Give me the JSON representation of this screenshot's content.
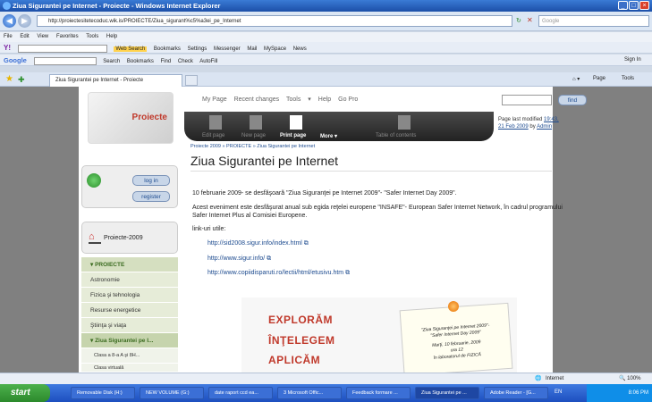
{
  "window": {
    "title": "Ziua Sigurantei pe Internet - Proiecte - Windows Internet Explorer"
  },
  "address": {
    "url": "http://proiectesitetecoduc.wik.is/PROIECTE/Ziua_sigurant%c5%a3ei_pe_Internet",
    "search_placeholder": "Google"
  },
  "menu": [
    "File",
    "Edit",
    "View",
    "Favorites",
    "Tools",
    "Help"
  ],
  "toolbar1": [
    "Web Search",
    "Bookmarks",
    "Settings",
    "Messenger",
    "Mail",
    "MySpace",
    "News"
  ],
  "toolbar2": [
    "Search",
    "Bookmarks",
    "Find",
    "Check",
    "AutoFill"
  ],
  "toolbar2_right": "Sign In",
  "tab": {
    "label": "Ziua Sigurantei pe Internet - Proiecte"
  },
  "cmdbar": [
    "Page",
    "Tools"
  ],
  "wiki": {
    "logo_text": "Proiecte",
    "login": "log in",
    "register": "register",
    "project_label": "Proiecte-2009",
    "sidebar": [
      "PROIECTE",
      "Astronomie",
      "Fizica şi tehnologia",
      "Resurse energetice",
      "Ştiinţa şi viaţa",
      "Ziua Sigurantei pe I...",
      "Clasa a 8-a A şi 8H...",
      "Clasa virtuală"
    ],
    "topnav": [
      "My Page",
      "Recent changes",
      "Tools",
      "Help",
      "Go Pro"
    ],
    "find": "find",
    "actions": [
      "Edit page",
      "New page",
      "Print page",
      "More",
      "Table of contents"
    ],
    "modified_prefix": "Page last modified",
    "modified_time": "19:43, 21 Feb 2009",
    "modified_by": "by",
    "modified_author": "Admin",
    "breadcrumb": "Proiecte 2009 » PROIECTE » Ziua Sigurantei pe Internet",
    "title": "Ziua Sigurantei pe Internet",
    "para1": "10 februarie 2009- se desfăşoară \"Ziua Siguranţei pe Internet 2009\"- \"Safer Internet Day 2009\".",
    "para2": "Acest eveniment este desfăşurat anual sub egida reţelei europene \"INSAFE\"- European Safer Internet Network, în cadrul programului Safer Internet Plus al Comisiei Europene.",
    "links_label": "link-uri utile:",
    "links": [
      "http://sid2008.sigur.info/index.html",
      "http://www.sigur.info/",
      "http://www.copiidisparuti.ro/lectii/html/etusivu.htm"
    ],
    "banner": [
      "EXPLORĂM",
      "ÎNŢELEGEM",
      "APLICĂM"
    ],
    "note": [
      "\"Ziua Siguranţei pe Internet 2009\"-",
      "\"Safer Internet Day 2009\"",
      "Marţi, 10 februarie, 2009",
      "ora 12",
      "în laboratorul de FIZICĂ"
    ]
  },
  "status": {
    "zone": "Internet",
    "zoom": "100%"
  },
  "taskbar": {
    "start": "start",
    "tasks": [
      "Removable Disk (H:)",
      "NEW VOLUME (G:)",
      "date raport ccd ea...",
      "3 Microsoft Offic...",
      "Feedback formare ...",
      "Ziua Sigurantei pe ...",
      "Adobe Reader - [G..."
    ],
    "lang": "EN",
    "clock": "8:06 PM"
  }
}
